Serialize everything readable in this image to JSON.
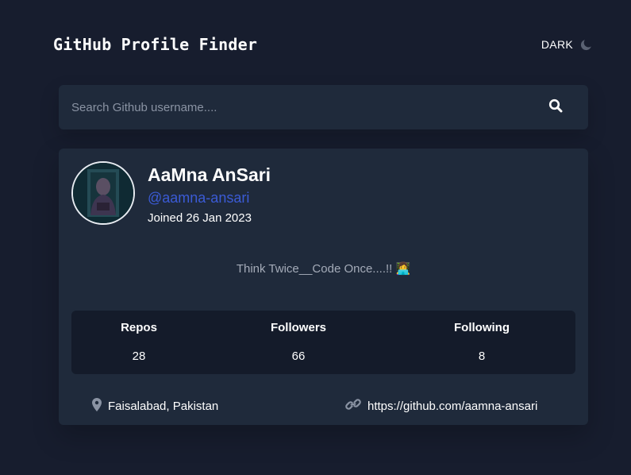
{
  "header": {
    "title": "GitHub Profile Finder",
    "theme_label": "DARK",
    "theme_icon": "moon-icon"
  },
  "search": {
    "placeholder": "Search Github username....",
    "value": "",
    "button_icon": "search-icon"
  },
  "profile": {
    "name": "AaMna AnSari",
    "username": "@aamna-ansari",
    "joined": "Joined 26 Jan 2023",
    "bio": "Think Twice__Code Once....!! 👩‍💻",
    "stats": [
      {
        "label": "Repos",
        "value": "28"
      },
      {
        "label": "Followers",
        "value": "66"
      },
      {
        "label": "Following",
        "value": "8"
      }
    ],
    "location": "Faisalabad, Pakistan",
    "blog": "https://github.com/aamna-ansari"
  },
  "colors": {
    "background": "#171d2e",
    "card": "#1f2a3b",
    "stats_panel": "#141b2a",
    "link": "#3b5bd6",
    "muted_text": "#a4abb8"
  }
}
